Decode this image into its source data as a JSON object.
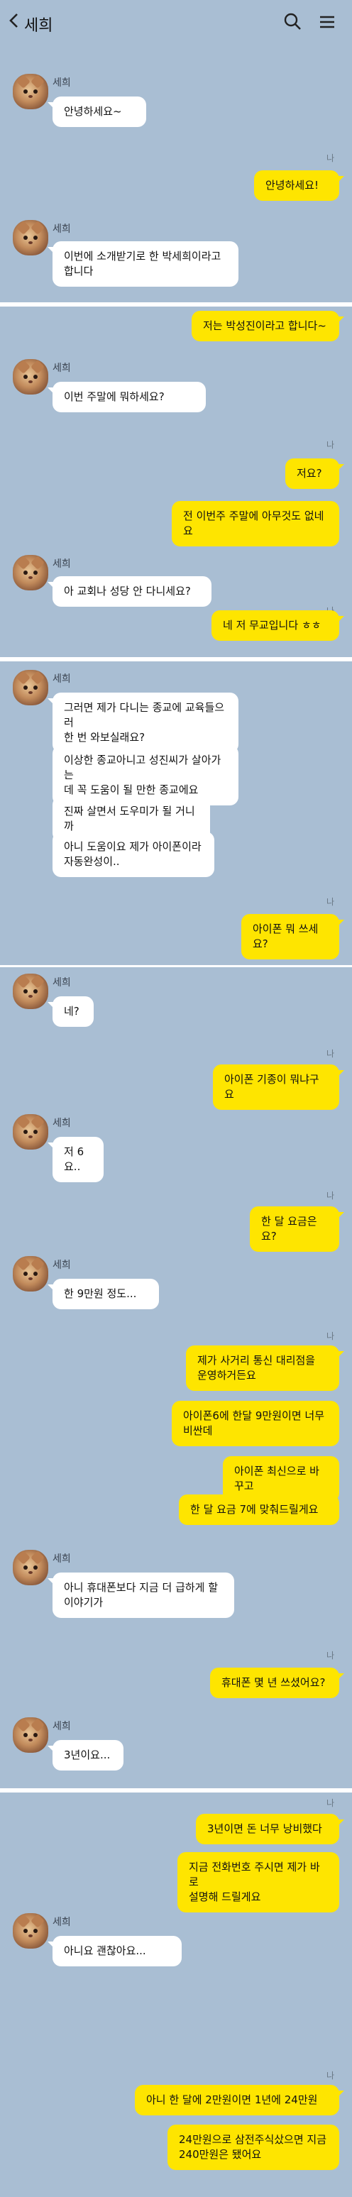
{
  "header": {
    "title": "세희",
    "back_icon": "chevron-left-icon",
    "search_icon": "search-icon",
    "menu_icon": "menu-icon"
  },
  "colors": {
    "background": "#a9bed3",
    "outgoing_bubble": "#fee500",
    "incoming_bubble": "#ffffff"
  },
  "contact": {
    "name": "세희"
  },
  "read_mark": "나",
  "messages": {
    "m1": "안녕하세요~",
    "m2": "안녕하세요!",
    "m3": "이번에 소개받기로 한 박세희이라고\n합니다",
    "m4": "저는 박성진이라고 합니다~",
    "m5": "이번 주말에 뭐하세요?",
    "m6": "저요?",
    "m7": "전 이번주 주말에 아무것도 없네요",
    "m8": "아 교회나 성당 안 다니세요?",
    "m9": "네 저 무교입니다 ㅎㅎ",
    "m10": "그러면 제가 다니는 종교에 교육들으러\n한 번 와보실래요?",
    "m11": "이상한 종교아니고 성진씨가 살아가는\n데 꼭 도움이 될 만한 종교에요",
    "m12": "진짜 살면서 도우미가 될 거니까",
    "m13": "아니 도움이요 제가 아이폰이라\n자동완성이..",
    "m14": "아이폰 뭐 쓰세요?",
    "m15": "네?",
    "m16": "아이폰 기종이 뭐냐구요",
    "m17": "저 6요..",
    "m18": "한 달 요금은요?",
    "m19": "한 9만원 정도...",
    "m20": "제가 사거리 통신 대리점을\n운영하거든요",
    "m21": "아이폰6에 한달 9만원이면 너무\n비싼데",
    "m22": "아이폰 최신으로 바꾸고",
    "m23": "한 달 요금 7에 맞춰드릴게요",
    "m24": "아니 휴대폰보다 지금 더 급하게 할\n이야기가",
    "m25": "휴대폰 몇 년 쓰셨어요?",
    "m26": "3년이요...",
    "m27": "3년이면 돈 너무 낭비했다",
    "m28": "지금 전화번호 주시면 제가 바로\n설명해 드릴게요",
    "m29": "아니요 괜찮아요...",
    "m30": "아니 한 달에 2만원이면 1년에 24만원",
    "m31": "24만원으로 삼전주식샀으면 지금\n240만원은 됐어요"
  }
}
